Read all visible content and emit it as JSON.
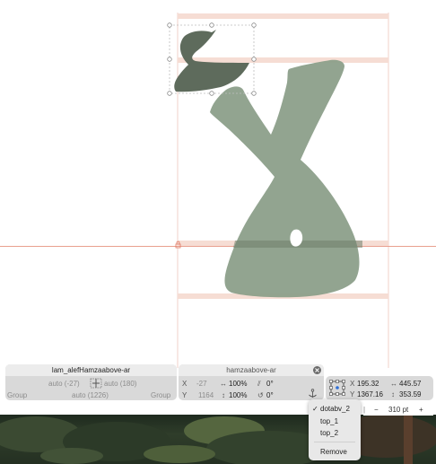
{
  "glyph_panel": {
    "name": "lam_alefHamzaabove-ar",
    "lsb": "auto (-27)",
    "rsb": "auto (180)",
    "width": "auto (1226)",
    "left_group": "Group",
    "right_group": "Group"
  },
  "component_panel": {
    "name": "hamzaabove-ar",
    "x_label": "X",
    "y_label": "Y",
    "x_value": "-27",
    "y_value": "1164",
    "scale_x": "100%",
    "scale_y": "100%",
    "slant": "0°",
    "rotation": "0°"
  },
  "transform_panel": {
    "x_label": "X",
    "y_label": "Y",
    "x_value": "195.32",
    "y_value": "1367.16",
    "width": "445.57",
    "height": "353.59"
  },
  "anchor_menu": {
    "items": [
      "dotabv_2",
      "top_1",
      "top_2"
    ],
    "selected": "dotabv_2",
    "remove_label": "Remove",
    "check": "✓"
  },
  "zoom": {
    "minus": "−",
    "value": "310 pt",
    "plus": "+"
  },
  "colors": {
    "glyph_fill": "#8c9f8a",
    "selected_component": "#5e6b5c",
    "metric_line": "#f1c9bc",
    "panel_bg": "#d9d9d9"
  },
  "icons": [
    "link-metrics-icon",
    "anchor-icon",
    "close-icon",
    "bounding-box-icon",
    "lock-icon"
  ]
}
